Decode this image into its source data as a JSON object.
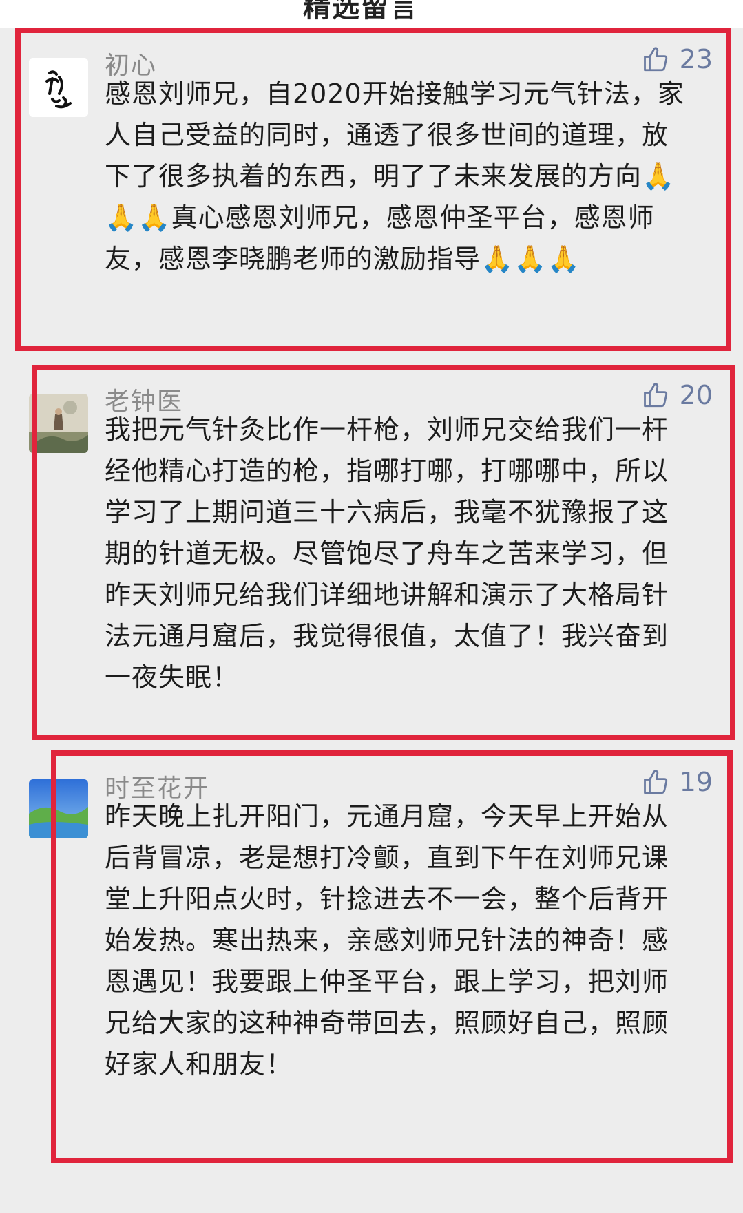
{
  "page": {
    "top_title": "精选留言"
  },
  "comments": [
    {
      "name": "初心",
      "avatar_label": "初心",
      "likes": "23",
      "text": "感恩刘师兄，自2020开始接触学习元气针法，家人自己受益的同时，通透了很多世间的道理，放下了很多执着的东西，明了了未来发展的方向🙏🙏🙏真心感恩刘师兄，感恩仲圣平台，感恩师友，感恩李晓鹏老师的激励指导🙏🙏🙏"
    },
    {
      "name": "老钟医",
      "likes": "20",
      "text": "我把元气针灸比作一杆枪，刘师兄交给我们一杆经他精心打造的枪，指哪打哪，打哪哪中，所以学习了上期问道三十六病后，我毫不犹豫报了这期的针道无极。尽管饱尽了舟车之苦来学习，但昨天刘师兄给我们详细地讲解和演示了大格局针法元通月窟后，我觉得很值，太值了！我兴奋到一夜失眠！"
    },
    {
      "name": "时至花开",
      "likes": "19",
      "text": "昨天晚上扎开阳门，元通月窟，今天早上开始从后背冒凉，老是想打冷颤，直到下午在刘师兄课堂上升阳点火时，针捻进去不一会，整个后背开始发热。寒出热来，亲感刘师兄针法的神奇！感恩遇见！我要跟上仲圣平台，跟上学习，把刘师兄给大家的这种神奇带回去，照顾好自己，照顾好家人和朋友！"
    }
  ],
  "colors": {
    "frame": "#e0243c",
    "background": "#ededed",
    "name": "#8a8a8a",
    "like": "#6a7aa0"
  }
}
